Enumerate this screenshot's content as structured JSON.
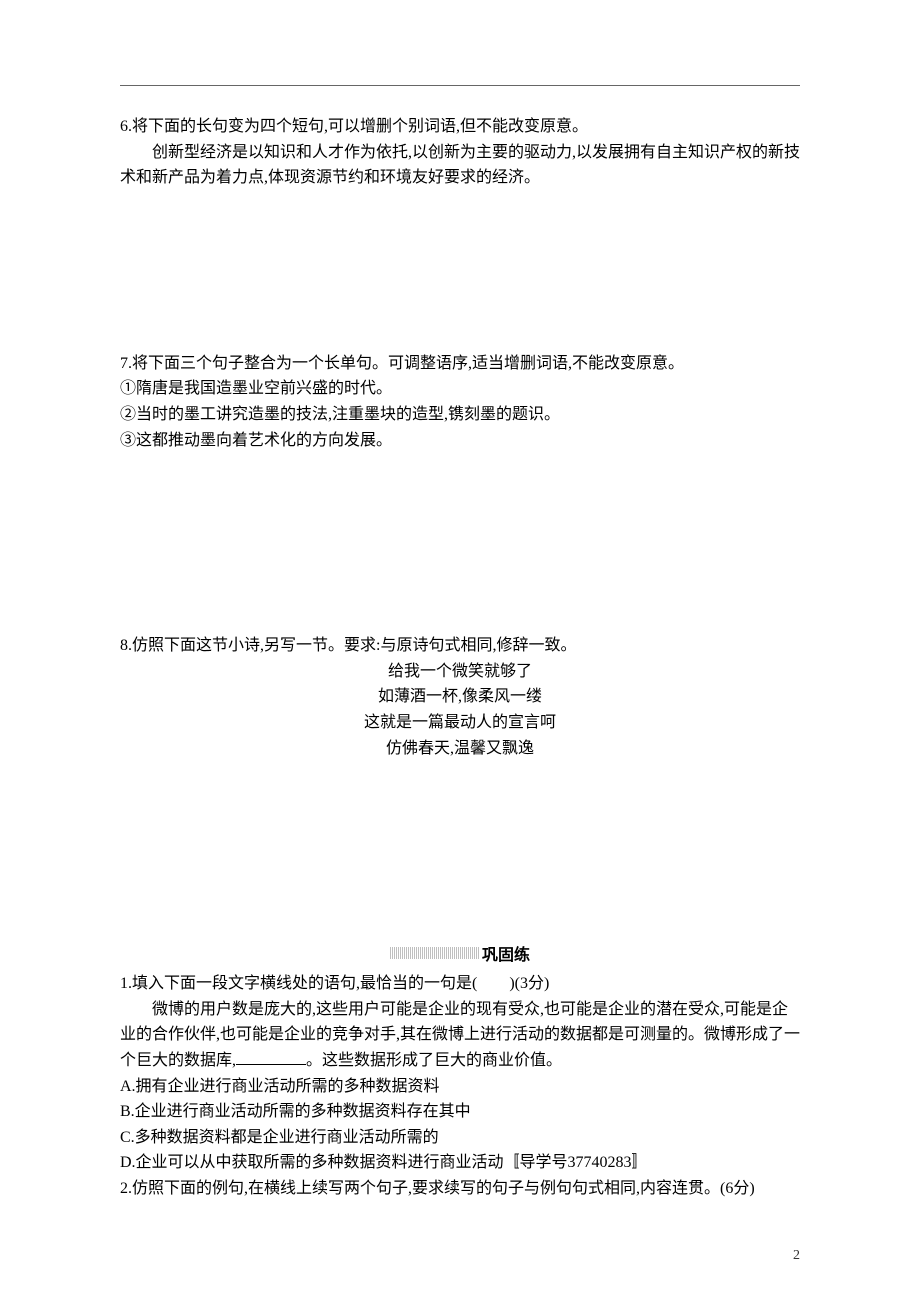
{
  "q6": {
    "prompt": "6.将下面的长句变为四个短句,可以增删个别词语,但不能改变原意。",
    "body": "创新型经济是以知识和人才作为依托,以创新为主要的驱动力,以发展拥有自主知识产权的新技术和新产品为着力点,体现资源节约和环境友好要求的经济。"
  },
  "q7": {
    "prompt": "7.将下面三个句子整合为一个长单句。可调整语序,适当增删词语,不能改变原意。",
    "items": [
      "①隋唐是我国造墨业空前兴盛的时代。",
      "②当时的墨工讲究造墨的技法,注重墨块的造型,镌刻墨的题识。",
      "③这都推动墨向着艺术化的方向发展。"
    ]
  },
  "q8": {
    "prompt": "8.仿照下面这节小诗,另写一节。要求:与原诗句式相同,修辞一致。",
    "poem": [
      "给我一个微笑就够了",
      "如薄酒一杯,像柔风一缕",
      "这就是一篇最动人的宣言呵",
      "仿佛春天,温馨又飘逸"
    ]
  },
  "section": {
    "title": "巩固练"
  },
  "p1": {
    "prompt_a": "1.填入下面一段文字横线处的语句,最恰当的一句是(　　)(3分)",
    "body_a": "微博的用户数是庞大的,这些用户可能是企业的现有受众,也可能是企业的潜在受众,可能是企业的合作伙伴,也可能是企业的竞争对手,其在微博上进行活动的数据都是可测量的。微博形成了一个巨大的数据库,",
    "body_b": "。这些数据形成了巨大的商业价值。",
    "options": [
      "A.拥有企业进行商业活动所需的多种数据资料",
      "B.企业进行商业活动所需的多种数据资料存在其中",
      "C.多种数据资料都是企业进行商业活动所需的",
      "D.企业可以从中获取所需的多种数据资料进行商业活动〚导学号37740283〛"
    ]
  },
  "p2": {
    "prompt": "2.仿照下面的例句,在横线上续写两个句子,要求续写的句子与例句句式相同,内容连贯。(6分)"
  },
  "page_number": "2"
}
